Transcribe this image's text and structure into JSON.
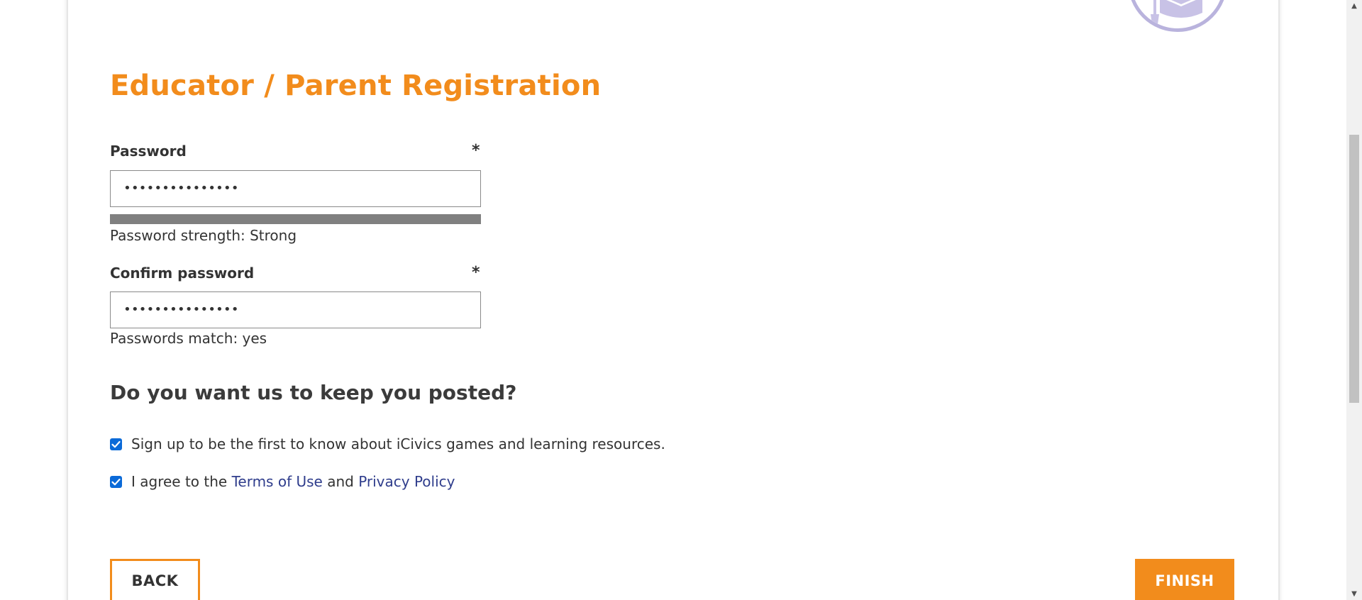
{
  "colors": {
    "accent": "#f28c1c",
    "step_done": "#1aaa6e",
    "step_current": "#555555",
    "link": "#2f3d8c",
    "badge": "#b9b3dd"
  },
  "steps": [
    {
      "status": "done"
    },
    {
      "status": "done"
    },
    {
      "status": "done"
    },
    {
      "status": "done"
    },
    {
      "status": "current"
    }
  ],
  "badge_icon": "graduation-cap-icon",
  "page": {
    "title": "Educator / Parent Registration"
  },
  "password": {
    "label": "Password",
    "required_mark": "*",
    "value": "•••••••••••••••",
    "strength_fill": 1.0,
    "strength_text": "Password strength: Strong"
  },
  "confirm_password": {
    "label": "Confirm password",
    "required_mark": "*",
    "value": "•••••••••••••••",
    "match_text": "Passwords match: yes"
  },
  "newsletter": {
    "heading": "Do you want us to keep you posted?",
    "signup": {
      "checked": true,
      "label": "Sign up to be the first to know about iCivics games and learning resources."
    },
    "terms": {
      "checked": true,
      "prefix": "I agree to the ",
      "terms_link": "Terms of Use",
      "middle": " and ",
      "privacy_link": "Privacy Policy"
    }
  },
  "actions": {
    "back_label": "BACK",
    "finish_label": "FINISH"
  }
}
